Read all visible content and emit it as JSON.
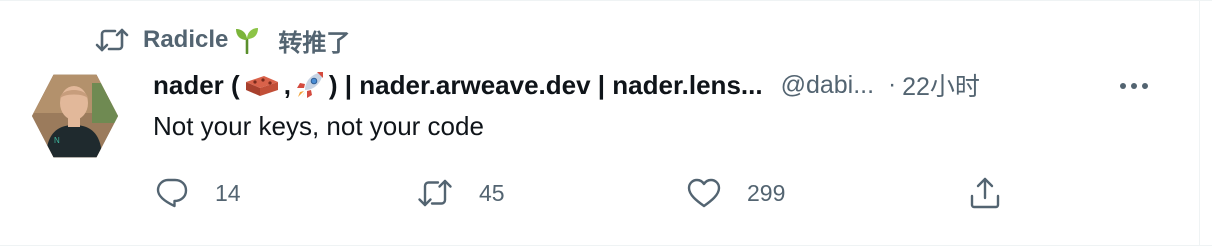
{
  "social_context": {
    "name": "Radicle",
    "emoji_icon": "sprout-icon",
    "action": "转推了"
  },
  "author": {
    "display_name_prefix": "nader (",
    "emoji_1": "brick-icon",
    "separator": ", ",
    "emoji_2": "rocket-icon",
    "display_name_suffix": ") | nader.arweave.dev | nader.lens...",
    "handle": "@dabi...",
    "dot": "·",
    "time": "22小时"
  },
  "tweet": {
    "text": "Not your keys, not your code"
  },
  "actions": {
    "reply_count": "14",
    "retweet_count": "45",
    "like_count": "299"
  },
  "colors": {
    "text_primary": "#0f1419",
    "text_secondary": "#536471",
    "border": "#eff3f4"
  }
}
